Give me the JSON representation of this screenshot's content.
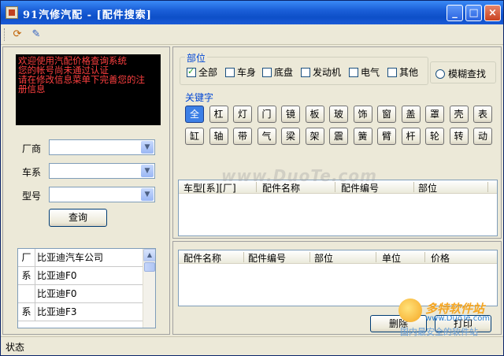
{
  "window": {
    "title": "91汽修汽配 - [配件搜索]",
    "minimize": "_",
    "maximize": "□",
    "close": "×"
  },
  "toolbar": {
    "icons": [
      "refresh-icon",
      "edit-icon"
    ],
    "refresh_glyph": "⟳",
    "edit_glyph": "✎"
  },
  "notice": {
    "lines": [
      "欢迎使用汽配价格查询系统",
      "您的帐号尚未通过认证",
      "请在修改信息菜单下完善您的注",
      "册信息"
    ]
  },
  "filters": {
    "manufacturer_label": "厂商",
    "series_label": "车系",
    "model_label": "型号",
    "query_button": "查询"
  },
  "manufacturer_list": [
    {
      "type": "厂",
      "name": "比亚迪汽车公司"
    },
    {
      "type": "系",
      "name": "比亚迪F0"
    },
    {
      "type": "",
      "name": "比亚迪F0"
    },
    {
      "type": "系",
      "name": "比亚迪F3"
    }
  ],
  "parts_section": {
    "title": "部位",
    "options": [
      {
        "label": "全部",
        "checked": true
      },
      {
        "label": "车身",
        "checked": false
      },
      {
        "label": "底盘",
        "checked": false
      },
      {
        "label": "发动机",
        "checked": false
      },
      {
        "label": "电气",
        "checked": false
      },
      {
        "label": "其他",
        "checked": false
      }
    ],
    "fuzzy_search": "模糊查找"
  },
  "keywords_section": {
    "title": "关键字",
    "row1": [
      "全",
      "杠",
      "灯",
      "门",
      "镜",
      "板",
      "玻",
      "饰",
      "窗",
      "盖",
      "罩",
      "壳",
      "表"
    ],
    "row2": [
      "缸",
      "轴",
      "带",
      "气",
      "梁",
      "架",
      "震",
      "簧",
      "臂",
      "杆",
      "轮",
      "转",
      "动"
    ],
    "active": "全"
  },
  "results_grid": {
    "columns": [
      "车型[系][厂]",
      "配件名称",
      "配件编号",
      "部位"
    ]
  },
  "detail_grid": {
    "columns": [
      "配件名称",
      "配件编号",
      "部位",
      "单位",
      "价格"
    ]
  },
  "actions": {
    "delete": "删除",
    "print": "打印"
  },
  "status": {
    "text": "状态"
  },
  "overlays": {
    "watermark": "www.DuoTe.com",
    "brand_title": "多特软件站",
    "brand_url": "www.DuoTe.com",
    "brand_tagline": "国内最安全的软件站"
  },
  "colors": {
    "titlebar": "#0d4fc8",
    "notice_bg": "#000000",
    "notice_text": "#ff4040",
    "accent_blue": "#0046d5",
    "active_key": "#3c7fe6"
  }
}
